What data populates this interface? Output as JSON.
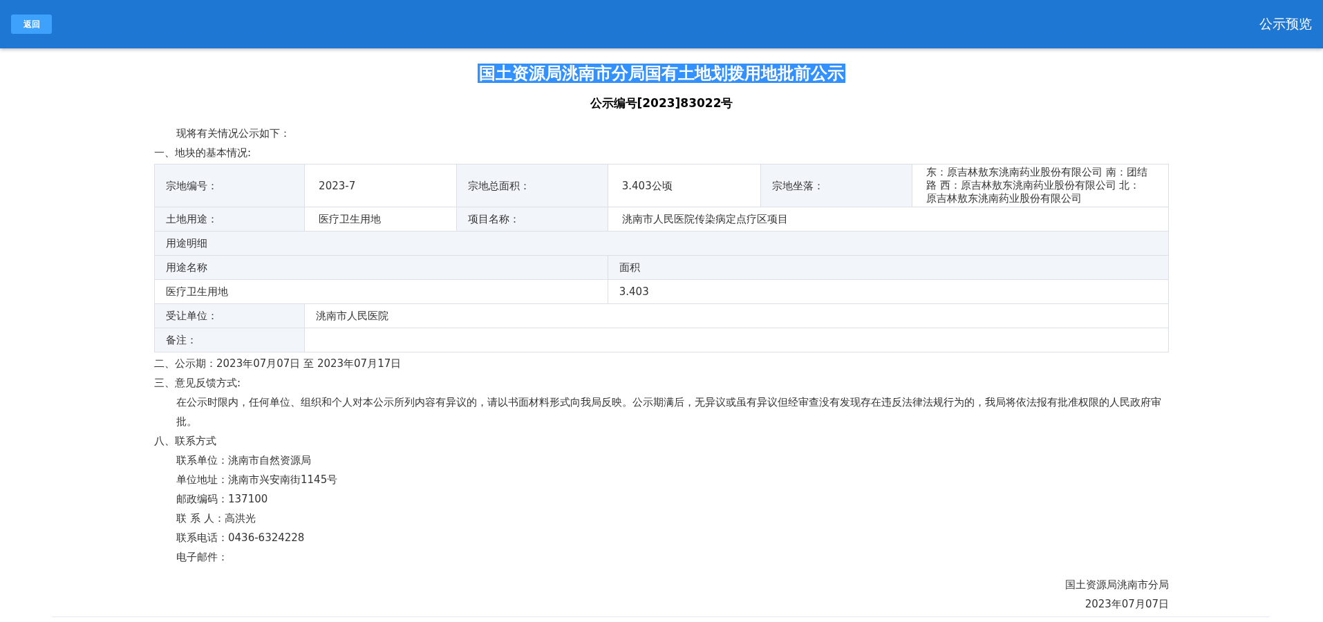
{
  "header": {
    "back_button": "返回",
    "title": "公示预览"
  },
  "document": {
    "title": {
      "text": "国土资源局洮南市分局国有土地划拨用地批前公示",
      "highlighted": true
    },
    "number": "公示编号[2023]83022号",
    "intro": "现将有关情况公示如下：",
    "section_1": "一、地块的基本情况:",
    "table": {
      "row_1": [
        {
          "label": "宗地编号：",
          "value": "2023-7"
        },
        {
          "label": "宗地总面积：",
          "value": "3.403公顷"
        },
        {
          "label": "宗地坐落：",
          "value": "东：原吉林敖东洮南药业股份有限公司 南：团结路 西：原吉林敖东洮南药业股份有限公司 北：原吉林敖东洮南药业股份有限公司"
        }
      ],
      "row_2": [
        {
          "label": "土地用途：",
          "value": "医疗卫生用地"
        },
        {
          "label": "项目名称：",
          "value": "洮南市人民医院传染病定点疗区项目"
        }
      ],
      "detail_title": "用途明细",
      "detail_columns": [
        "用途名称",
        "面积"
      ],
      "detail_rows": [
        [
          "医疗卫生用地",
          "3.403"
        ]
      ],
      "transferee": {
        "label": "受让单位：",
        "value": "洮南市人民医院"
      },
      "remarks": {
        "label": "备注："
      }
    },
    "section_2": "二、公示期：2023年07月07日 至 2023年07月17日",
    "section_3": "三、意见反馈方式:",
    "feedback": "在公示时限内，任何单位、组织和个人对本公示所列内容有异议的，请以书面材料形式向我局反映。公示期满后，无异议或虽有异议但经审查没有发现存在违反法律法规行为的，我局将依法报有批准权限的人民政府审批。",
    "section_8": "八、联系方式",
    "contacts": [
      "联系单位：洮南市自然资源局",
      "单位地址：洮南市兴安南街1145号",
      "邮政编码：137100",
      "联 系 人：高洪光",
      "联系电话：0436-6324228",
      "电子邮件："
    ],
    "signature": {
      "issuer": "国土资源局洮南市分局",
      "date": "2023年07月07日"
    }
  }
}
